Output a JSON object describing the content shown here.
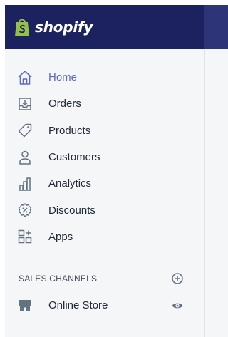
{
  "app": {
    "brand_name": "shopify",
    "brand_icon": "shopify-bag-icon",
    "topbar_color": "#1c2260",
    "accent_color": "#5c6ac4",
    "brand_green": "#95bf47"
  },
  "nav": {
    "items": [
      {
        "label": "Home",
        "icon": "home-icon",
        "active": true
      },
      {
        "label": "Orders",
        "icon": "orders-icon",
        "active": false
      },
      {
        "label": "Products",
        "icon": "products-tag-icon",
        "active": false
      },
      {
        "label": "Customers",
        "icon": "customers-icon",
        "active": false
      },
      {
        "label": "Analytics",
        "icon": "analytics-icon",
        "active": false
      },
      {
        "label": "Discounts",
        "icon": "discounts-icon",
        "active": false
      },
      {
        "label": "Apps",
        "icon": "apps-icon",
        "active": false
      }
    ]
  },
  "sales_channels": {
    "title": "SALES CHANNELS",
    "add_icon": "add-circle-icon",
    "channels": [
      {
        "label": "Online Store",
        "icon": "online-store-icon",
        "action_icon": "eye-icon"
      }
    ]
  }
}
